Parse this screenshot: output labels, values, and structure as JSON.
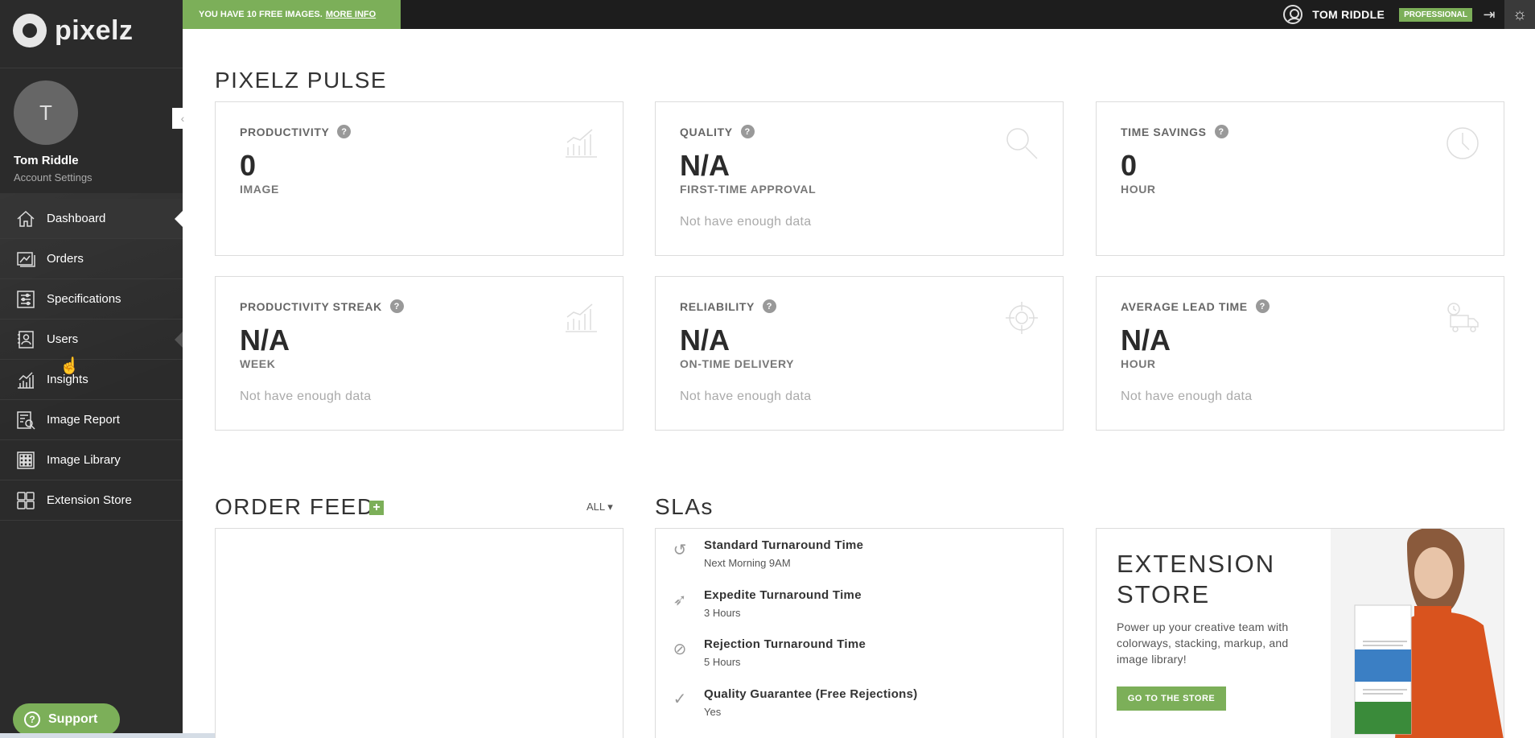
{
  "brand": {
    "name": "pixelz"
  },
  "topbar": {
    "promo_text": "YOU HAVE 10 FREE IMAGES.",
    "promo_link": "MORE INFO",
    "user_name": "TOM RIDDLE",
    "plan_badge": "PROFESSIONAL"
  },
  "profile": {
    "initial": "T",
    "name": "Tom Riddle",
    "settings_link": "Account Settings"
  },
  "sidebar": {
    "items": [
      {
        "label": "Dashboard",
        "icon": "home-icon",
        "active": true
      },
      {
        "label": "Orders",
        "icon": "orders-icon"
      },
      {
        "label": "Specifications",
        "icon": "sliders-icon"
      },
      {
        "label": "Users",
        "icon": "users-icon"
      },
      {
        "label": "Insights",
        "icon": "chart-icon"
      },
      {
        "label": "Image Report",
        "icon": "report-icon"
      },
      {
        "label": "Image Library",
        "icon": "library-icon"
      },
      {
        "label": "Extension Store",
        "icon": "store-icon"
      }
    ],
    "support_label": "Support"
  },
  "pulse": {
    "title": "PIXELZ PULSE",
    "cards": [
      {
        "label": "PRODUCTIVITY",
        "value": "0",
        "unit": "IMAGE",
        "note": "",
        "icon": "bar-chart-icon"
      },
      {
        "label": "QUALITY",
        "value": "N/A",
        "unit": "FIRST-TIME APPROVAL",
        "note": "Not have enough data",
        "icon": "magnifier-icon"
      },
      {
        "label": "TIME SAVINGS",
        "value": "0",
        "unit": "HOUR",
        "note": "",
        "icon": "clock-icon"
      },
      {
        "label": "PRODUCTIVITY STREAK",
        "value": "N/A",
        "unit": "WEEK",
        "note": "Not have enough data",
        "icon": "bar-chart-icon"
      },
      {
        "label": "RELIABILITY",
        "value": "N/A",
        "unit": "ON-TIME DELIVERY",
        "note": "Not have enough data",
        "icon": "target-icon"
      },
      {
        "label": "AVERAGE LEAD TIME",
        "value": "N/A",
        "unit": "HOUR",
        "note": "Not have enough data",
        "icon": "truck-icon"
      }
    ]
  },
  "order_feed": {
    "title": "ORDER FEED",
    "filter": "ALL"
  },
  "slas": {
    "title": "SLAs",
    "items": [
      {
        "title": "Standard Turnaround Time",
        "value": "Next Morning 9AM",
        "icon": "history-icon"
      },
      {
        "title": "Expedite Turnaround Time",
        "value": "3 Hours",
        "icon": "rocket-icon"
      },
      {
        "title": "Rejection Turnaround Time",
        "value": "5 Hours",
        "icon": "ban-icon"
      },
      {
        "title": "Quality Guarantee (Free Rejections)",
        "value": "Yes",
        "icon": "check-icon"
      }
    ]
  },
  "extension_store": {
    "title": "EXTENSION STORE",
    "description": "Power up your creative team with colorways, stacking, markup, and image library!",
    "button": "GO TO THE STORE"
  }
}
